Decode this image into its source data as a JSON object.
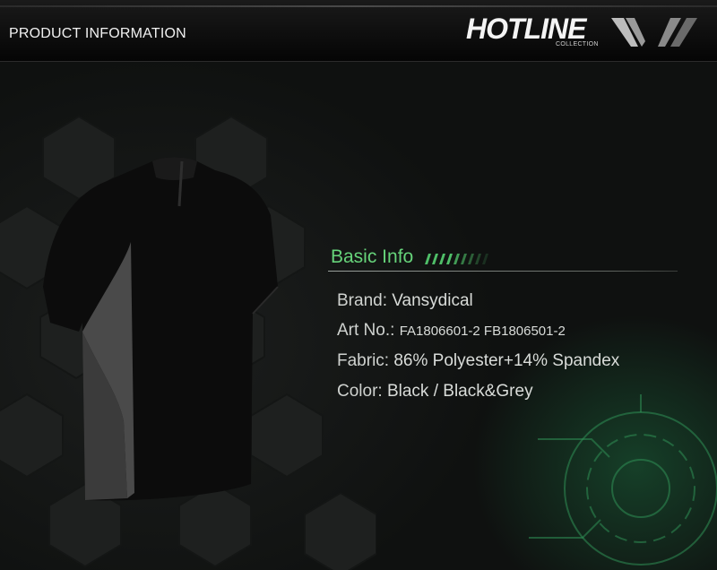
{
  "header": {
    "title": "PRODUCT INFORMATION",
    "brand_name": "HOTLINE",
    "brand_tagline": "COLLECTION"
  },
  "basic_info": {
    "heading": "Basic Info",
    "rows": [
      {
        "label": "Brand:",
        "value": "Vansydical"
      },
      {
        "label": "Art No.:",
        "value": "FA1806601-2 FB1806501-2"
      },
      {
        "label": "Fabric:",
        "value": "86% Polyester+14% Spandex"
      },
      {
        "label": "Color:",
        "value": "Black / Black&Grey"
      }
    ]
  },
  "colors": {
    "accent_green": "#66d37a",
    "background": "#111312"
  },
  "icons": {
    "brand_mark": "slash-stripes-icon",
    "heading_deco": "progress-stripes-icon"
  }
}
